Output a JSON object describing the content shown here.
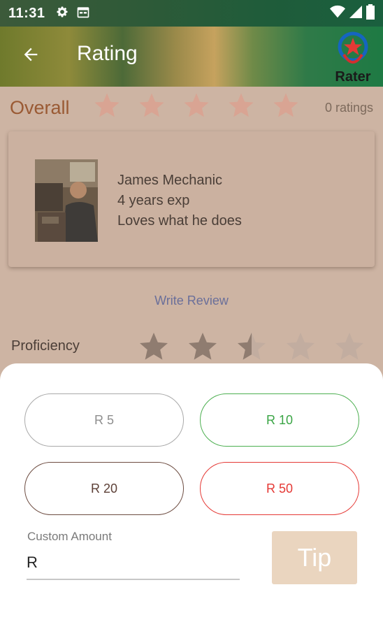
{
  "status_bar": {
    "time": "11:31"
  },
  "app_bar": {
    "title": "Rating",
    "logo_text": "Rater"
  },
  "overall": {
    "label": "Overall",
    "star_count": 5,
    "rating": 0,
    "ratings_count_text": "0 ratings"
  },
  "profile": {
    "name": "James Mechanic",
    "experience": "4 years exp",
    "bio": "Loves what he does"
  },
  "write_review_label": "Write Review",
  "proficiency": {
    "label": "Proficiency",
    "rating": 2.5,
    "star_count": 5
  },
  "tip_sheet": {
    "amounts": [
      "R 5",
      "R 10",
      "R 20",
      "R 50"
    ],
    "custom_label": "Custom Amount",
    "custom_value": "R",
    "tip_button_label": "Tip"
  },
  "colors": {
    "accent_green": "#4caf50",
    "accent_red": "#e53935",
    "accent_brown": "#6d4c41",
    "tip_button": "#ead5bf"
  }
}
